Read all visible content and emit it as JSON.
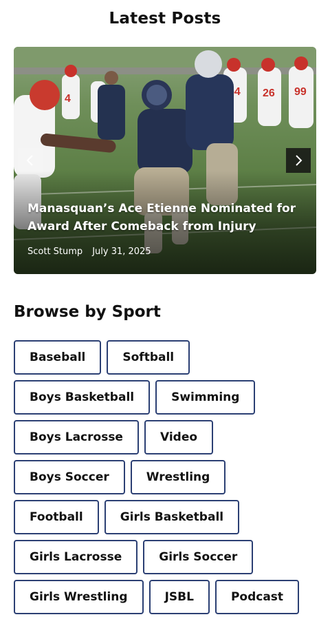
{
  "page": {
    "title": "Latest Posts"
  },
  "featured_post": {
    "headline": "Manasquan’s Ace Etienne Nominated for Award After Comeback from Injury",
    "author": "Scott Stump",
    "date": "July 31, 2025",
    "prev_icon": "chevron-left-icon",
    "next_icon": "chevron-right-icon"
  },
  "browse": {
    "title": "Browse by Sport",
    "sports": [
      "Baseball",
      "Softball",
      "Boys Basketball",
      "Swimming",
      "Boys Lacrosse",
      "Video",
      "Boys Soccer",
      "Wrestling",
      "Football",
      "Girls Basketball",
      "Girls Lacrosse",
      "Girls Soccer",
      "Girls Wrestling",
      "JSBL",
      "Podcast"
    ]
  },
  "colors": {
    "chip_border": "#2b3f73",
    "next_button_bg": "#141414"
  }
}
